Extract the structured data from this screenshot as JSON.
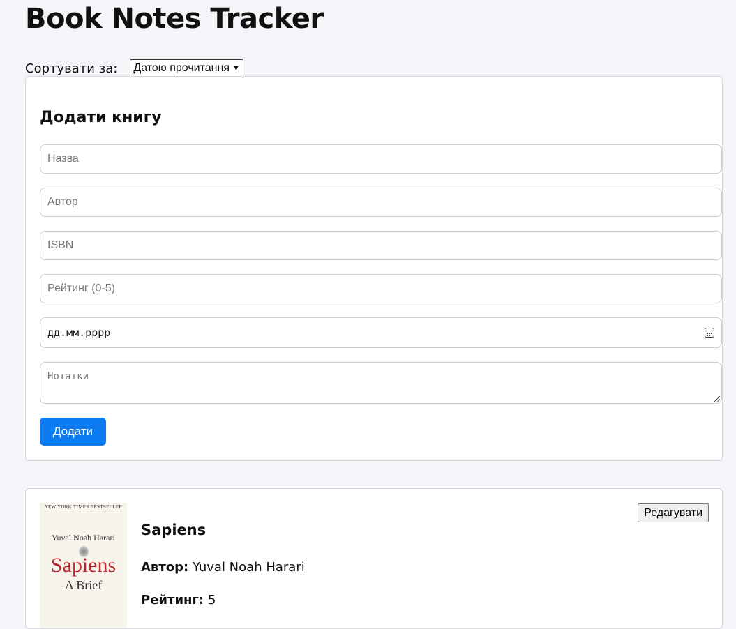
{
  "header": {
    "title": "Book Notes Tracker"
  },
  "sort": {
    "label": "Сортувати за:",
    "selected": "Датою прочитання"
  },
  "form": {
    "title": "Додати книгу",
    "title_placeholder": "Назва",
    "author_placeholder": "Автор",
    "isbn_placeholder": "ISBN",
    "rating_placeholder": "Рейтинг (0-5)",
    "date_placeholder": "дд.мм.рррр",
    "notes_placeholder": "Нотатки",
    "submit_label": "Додати"
  },
  "books": [
    {
      "title": "Sapiens",
      "author_label": "Автор:",
      "author": "Yuval Noah Harari",
      "rating_label": "Рейтинг:",
      "rating": "5",
      "edit_label": "Редагувати",
      "cover": {
        "bestseller": "NEW YORK TIMES BESTSELLER",
        "author": "Yuval Noah Harari",
        "title": "Sapiens",
        "subtitle": "A Brief"
      }
    }
  ]
}
